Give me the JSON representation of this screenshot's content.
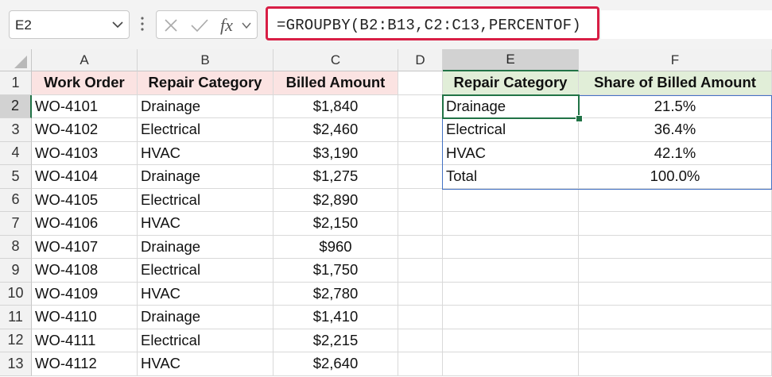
{
  "formula_bar": {
    "name_box": "E2",
    "fx_label": "fx",
    "formula": "=GROUPBY(B2:B13,C2:C13,PERCENTOF)"
  },
  "columns": [
    "A",
    "B",
    "C",
    "D",
    "E",
    "F"
  ],
  "rows": [
    "1",
    "2",
    "3",
    "4",
    "5",
    "6",
    "7",
    "8",
    "9",
    "10",
    "11",
    "12",
    "13"
  ],
  "source_table": {
    "headers": [
      "Work Order",
      "Repair Category",
      "Billed Amount"
    ],
    "rows": [
      [
        "WO-4101",
        "Drainage",
        "$1,840"
      ],
      [
        "WO-4102",
        "Electrical",
        "$2,460"
      ],
      [
        "WO-4103",
        "HVAC",
        "$3,190"
      ],
      [
        "WO-4104",
        "Drainage",
        "$1,275"
      ],
      [
        "WO-4105",
        "Electrical",
        "$2,890"
      ],
      [
        "WO-4106",
        "HVAC",
        "$2,150"
      ],
      [
        "WO-4107",
        "Drainage",
        "$960"
      ],
      [
        "WO-4108",
        "Electrical",
        "$1,750"
      ],
      [
        "WO-4109",
        "HVAC",
        "$2,780"
      ],
      [
        "WO-4110",
        "Drainage",
        "$1,410"
      ],
      [
        "WO-4111",
        "Electrical",
        "$2,215"
      ],
      [
        "WO-4112",
        "HVAC",
        "$2,640"
      ]
    ]
  },
  "result_table": {
    "headers": [
      "Repair Category",
      "Share of Billed Amount"
    ],
    "rows": [
      [
        "Drainage",
        "21.5%"
      ],
      [
        "Electrical",
        "36.4%"
      ],
      [
        "HVAC",
        "42.1%"
      ],
      [
        "Total",
        "100.0%"
      ]
    ]
  },
  "colors": {
    "source_header_fill": "#fbe3e2",
    "result_header_fill": "#e1eed8",
    "selection": "#217346",
    "table_border": "#4472c4",
    "formula_highlight": "#d81e45"
  }
}
